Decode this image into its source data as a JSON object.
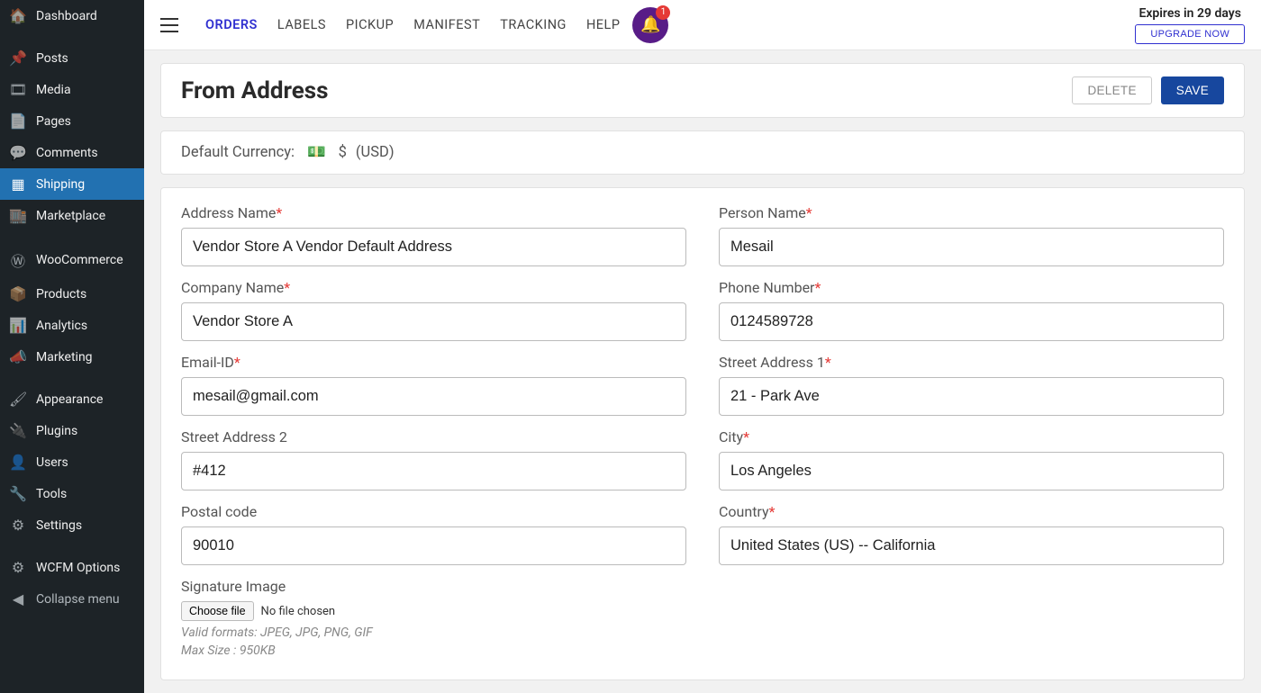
{
  "sidebar": {
    "items": [
      {
        "icon": "dashboard-icon",
        "glyph": "🏠",
        "label": "Dashboard"
      },
      {
        "icon": "pin-icon",
        "glyph": "📌",
        "label": "Posts"
      },
      {
        "icon": "media-icon",
        "glyph": "🎞",
        "label": "Media"
      },
      {
        "icon": "pages-icon",
        "glyph": "📄",
        "label": "Pages"
      },
      {
        "icon": "comments-icon",
        "glyph": "💬",
        "label": "Comments"
      },
      {
        "icon": "shipping-icon",
        "glyph": "▦",
        "label": "Shipping",
        "active": true
      },
      {
        "icon": "marketplace-icon",
        "glyph": "🏬",
        "label": "Marketplace"
      },
      {
        "icon": "woocommerce-icon",
        "glyph": "Ⓦ",
        "label": "WooCommerce"
      },
      {
        "icon": "products-icon",
        "glyph": "📦",
        "label": "Products"
      },
      {
        "icon": "analytics-icon",
        "glyph": "📊",
        "label": "Analytics"
      },
      {
        "icon": "marketing-icon",
        "glyph": "📣",
        "label": "Marketing"
      },
      {
        "icon": "appearance-icon",
        "glyph": "🖌",
        "label": "Appearance"
      },
      {
        "icon": "plugins-icon",
        "glyph": "🔌",
        "label": "Plugins"
      },
      {
        "icon": "users-icon",
        "glyph": "👤",
        "label": "Users"
      },
      {
        "icon": "tools-icon",
        "glyph": "🔧",
        "label": "Tools"
      },
      {
        "icon": "settings-icon",
        "glyph": "⚙",
        "label": "Settings"
      },
      {
        "icon": "wcfm-icon",
        "glyph": "⚙",
        "label": "WCFM Options"
      },
      {
        "icon": "collapse-icon",
        "glyph": "◀",
        "label": "Collapse menu",
        "muted": true
      }
    ]
  },
  "topbar": {
    "tabs": [
      {
        "label": "ORDERS",
        "active": true
      },
      {
        "label": "LABELS"
      },
      {
        "label": "PICKUP"
      },
      {
        "label": "MANIFEST"
      },
      {
        "label": "TRACKING"
      },
      {
        "label": "HELP"
      }
    ],
    "notifications_badge": "1",
    "expires": "Expires in 29 days",
    "upgrade": "UPGRADE NOW"
  },
  "header": {
    "title": "From Address",
    "delete": "DELETE",
    "save": "SAVE"
  },
  "currency": {
    "label": "Default Currency:",
    "symbol": "$",
    "code": "(USD)"
  },
  "form": {
    "address_name": {
      "label": "Address Name",
      "value": "Vendor Store A Vendor Default Address"
    },
    "person_name": {
      "label": "Person Name",
      "value": "Mesail"
    },
    "company_name": {
      "label": "Company Name",
      "value": "Vendor Store A"
    },
    "phone": {
      "label": "Phone Number",
      "value": "0124589728"
    },
    "email": {
      "label": "Email-ID",
      "value": "mesail@gmail.com"
    },
    "street1": {
      "label": "Street Address 1",
      "value": "21 - Park Ave"
    },
    "street2": {
      "label": "Street Address 2",
      "value": "#412"
    },
    "city": {
      "label": "City",
      "value": "Los Angeles"
    },
    "postal": {
      "label": "Postal code",
      "value": "90010"
    },
    "country": {
      "label": "Country",
      "value": "United States (US) -- California"
    },
    "signature": {
      "label": "Signature Image",
      "choose": "Choose file",
      "nofile": "No file chosen",
      "hint1": "Valid formats: JPEG, JPG, PNG, GIF",
      "hint2": "Max Size : 950KB"
    }
  }
}
